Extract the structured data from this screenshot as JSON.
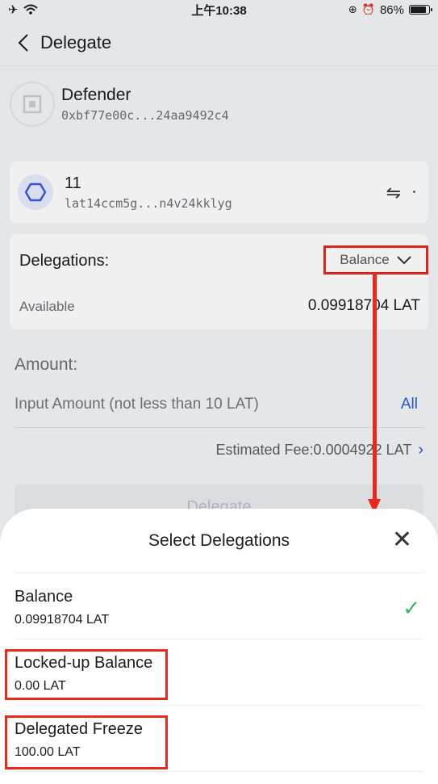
{
  "status_bar": {
    "time": "上午10:38",
    "battery": "86%",
    "battery_level": 0.86
  },
  "nav": {
    "back_icon": "chevron-left-icon",
    "title": "Delegate"
  },
  "validator": {
    "name": "Defender",
    "address": "0xbf77e00c...24aa9492c4"
  },
  "wallet": {
    "name": "11",
    "address": "lat14ccm5g...n4v24kklyg"
  },
  "delegations": {
    "label": "Delegations:",
    "selected": "Balance",
    "available_label": "Available",
    "available_value": "0.09918704 LAT"
  },
  "amount": {
    "label": "Amount:",
    "placeholder": "Input Amount (not less than 10 LAT)",
    "all_label": "All",
    "fee": "Estimated Fee:0.0004922 LAT"
  },
  "delegate_button": "Delegate",
  "sheet": {
    "title": "Select Delegations",
    "options": [
      {
        "name": "Balance",
        "value": "0.09918704 LAT",
        "selected": true
      },
      {
        "name": "Locked-up Balance",
        "value": "0.00 LAT",
        "selected": false
      },
      {
        "name": "Delegated Freeze",
        "value": "100.00 LAT",
        "selected": false
      }
    ]
  },
  "colors": {
    "accent": "#2a5ae8",
    "highlight": "#e8291c",
    "check": "#3cb45c"
  }
}
